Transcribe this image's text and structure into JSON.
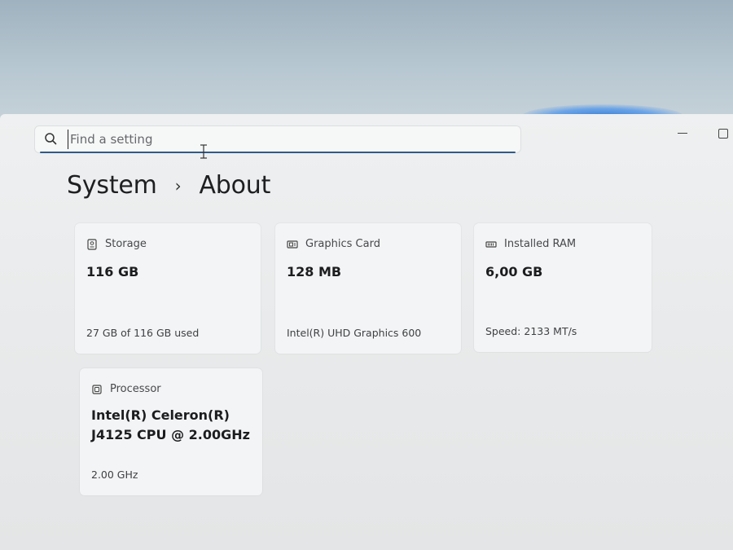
{
  "search": {
    "placeholder": "Find a setting",
    "icon": "search-icon"
  },
  "breadcrumb": {
    "parent": "System",
    "separator": "›",
    "current": "About"
  },
  "cards": {
    "storage": {
      "title": "Storage",
      "icon": "storage-drive-icon",
      "value": "116 GB",
      "detail": "27 GB of 116 GB used"
    },
    "graphics": {
      "title": "Graphics Card",
      "icon": "graphics-card-icon",
      "value": "128 MB",
      "detail": "Intel(R) UHD Graphics 600"
    },
    "ram": {
      "title": "Installed RAM",
      "icon": "memory-icon",
      "value": "6,00 GB",
      "detail": "Speed: 2133 MT/s"
    },
    "processor": {
      "title": "Processor",
      "icon": "processor-icon",
      "value": "Intel(R) Celeron(R) J4125 CPU @ 2.00GHz",
      "detail": "2.00 GHz"
    }
  },
  "colors": {
    "accent": "#2f5a87",
    "window_bg": "#eceeef",
    "card_bg": "#f3f4f5"
  }
}
